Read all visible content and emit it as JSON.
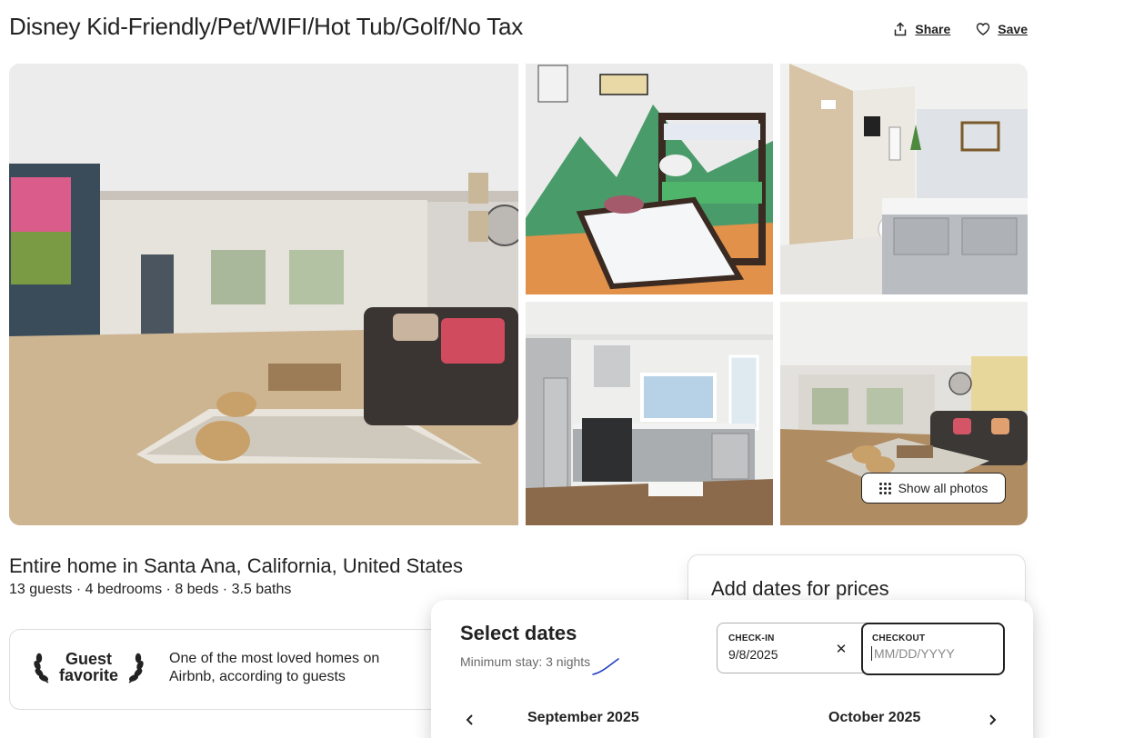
{
  "header": {
    "title": "Disney Kid-Friendly/Pet/WIFI/Hot Tub/Golf/No Tax",
    "share_label": "Share",
    "save_label": "Save",
    "share_icon": "share-icon",
    "save_icon": "heart-icon"
  },
  "photos": {
    "show_all_label": "Show all photos",
    "show_all_icon": "grid-dots-icon"
  },
  "listing": {
    "title": "Entire home in Santa Ana, California, United States",
    "details": "13 guests · 4 bedrooms · 8 beds · 3.5 baths"
  },
  "guest_favorite": {
    "line1": "Guest",
    "line2": "favorite",
    "description": "One of the most loved homes on Airbnb, according to guests",
    "icon": "laurel-icon"
  },
  "booking": {
    "heading": "Add dates for prices"
  },
  "date_picker": {
    "title": "Select dates",
    "subtitle": "Minimum stay: 3 nights",
    "checkin_label": "CHECK-IN",
    "checkin_value": "9/8/2025",
    "checkout_label": "CHECKOUT",
    "checkout_placeholder": "MM/DD/YYYY",
    "checkout_value": "",
    "clear_icon": "close-icon",
    "month_left": "September 2025",
    "month_right": "October 2025",
    "prev_icon": "chevron-left-icon",
    "next_icon": "chevron-right-icon"
  },
  "colors": {
    "text": "#222222",
    "muted": "#6a6a6a",
    "border": "#dddddd"
  }
}
